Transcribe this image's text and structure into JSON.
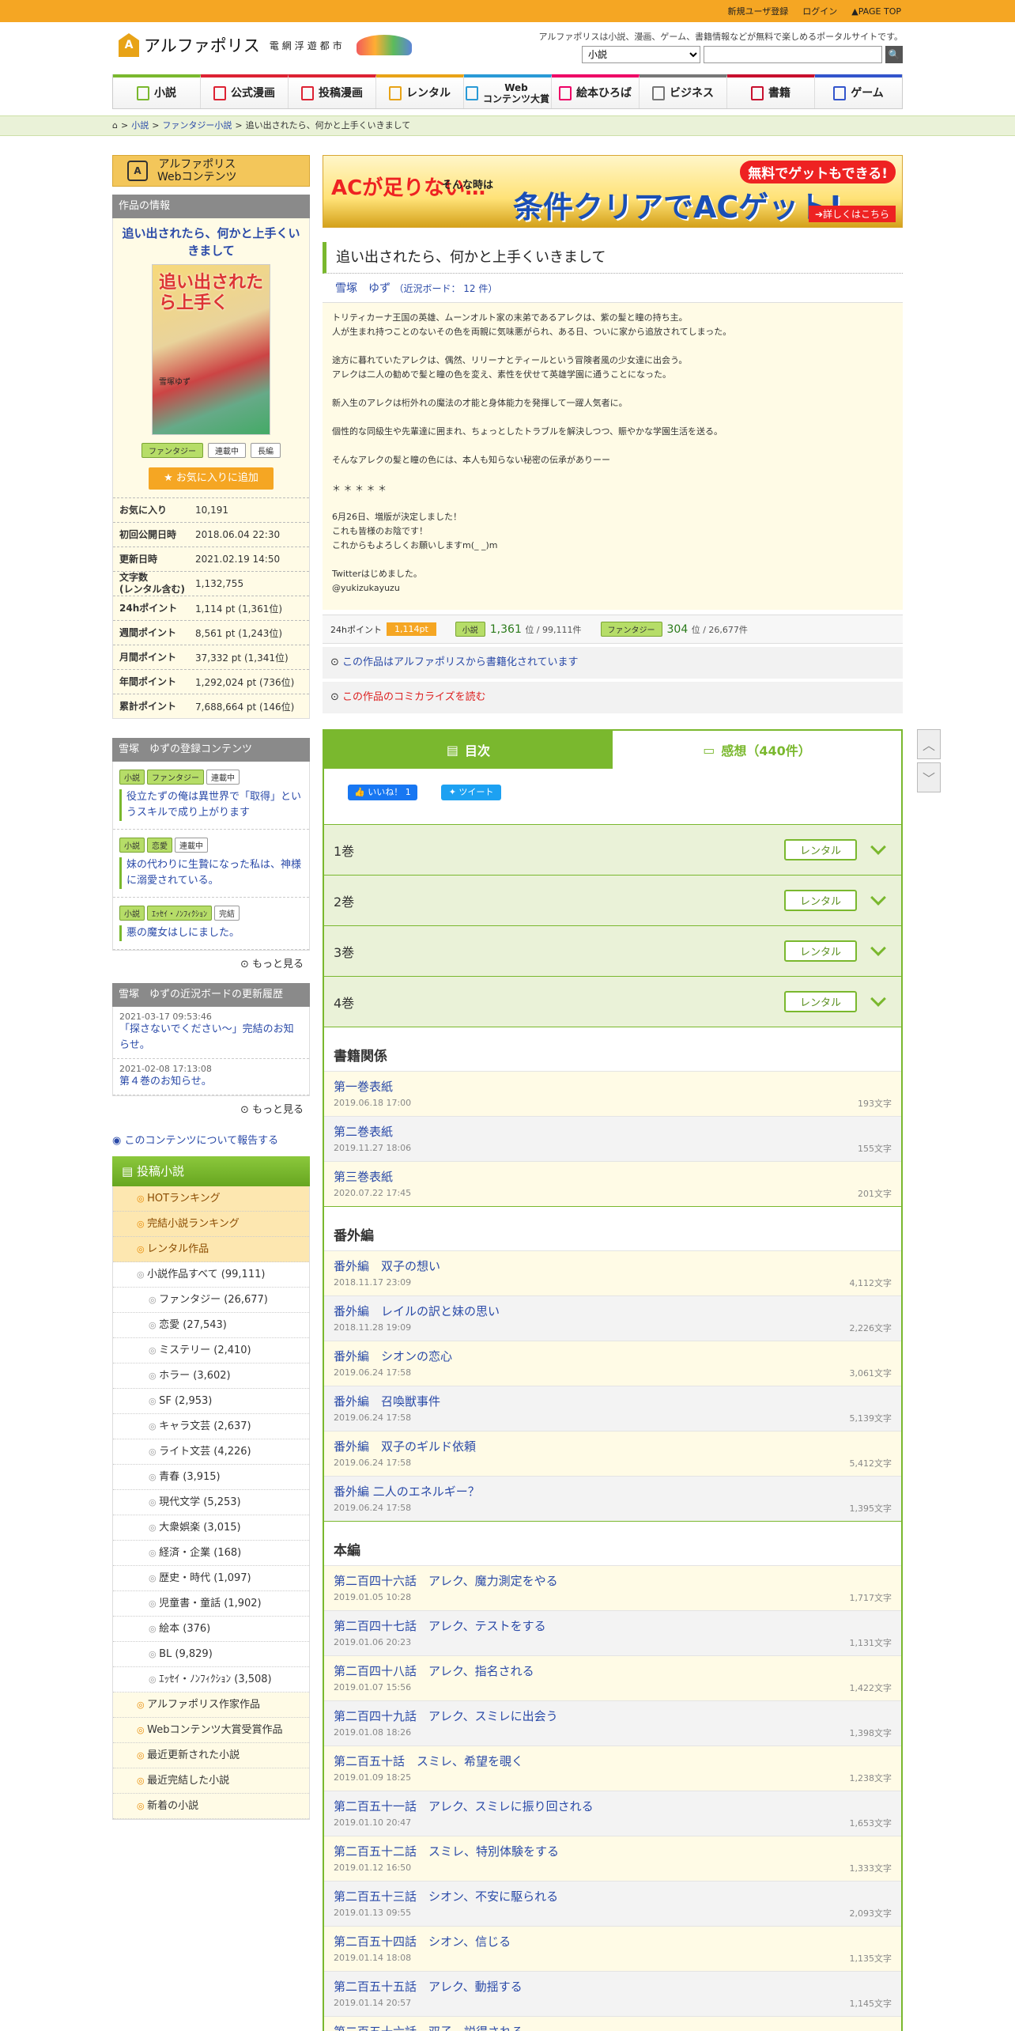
{
  "topbar": {
    "register": "新規ユーザ登録",
    "login": "ログイン",
    "pagetop": "PAGE TOP"
  },
  "header": {
    "logo_mark": "A",
    "logo": "アルファポリス",
    "logo_sub": "電網浮遊都市",
    "tagline": "アルファポリスは小説、漫画、ゲーム、書籍情報などが無料で楽しめるポータルサイトです。",
    "search_category": "小説",
    "search_icon": "search-icon"
  },
  "nav": [
    {
      "label": "小説",
      "color": "#7ab82e"
    },
    {
      "label": "公式漫画",
      "color": "#d23"
    },
    {
      "label": "投稿漫画",
      "color": "#d23"
    },
    {
      "label": "レンタル",
      "color": "#e8a317"
    },
    {
      "label": "Web\nコンテンツ大賞",
      "color": "#2a9ad6"
    },
    {
      "label": "絵本ひろば",
      "color": "#e06"
    },
    {
      "label": "ビジネス",
      "color": "#777"
    },
    {
      "label": "書籍",
      "color": "#c8102e"
    },
    {
      "label": "ゲーム",
      "color": "#35c"
    }
  ],
  "breadcrumb": [
    "小説",
    "ファンタジー小説",
    "追い出されたら、何かと上手くいきまして"
  ],
  "sidebar": {
    "banner_line1": "アルファポリス",
    "banner_line2": "Webコンテンツ",
    "info_head": "作品の情報",
    "title": "追い出されたら、何かと上手くいきまして",
    "cover_title": "追い出されたら上手く",
    "cover_author": "雪塚ゆず",
    "tags": [
      "ファンタジー",
      "連載中",
      "長編"
    ],
    "fav_button": "お気に入りに追加",
    "stats": [
      {
        "k": "お気に入り",
        "v": "10,191"
      },
      {
        "k": "初回公開日時",
        "v": "2018.06.04 22:30"
      },
      {
        "k": "更新日時",
        "v": "2021.02.19 14:50"
      },
      {
        "k": "文字数\n(レンタル含む)",
        "v": "1,132,755"
      },
      {
        "k": "24hポイント",
        "v": "1,114 pt (1,361位)"
      },
      {
        "k": "週間ポイント",
        "v": "8,561 pt (1,243位)"
      },
      {
        "k": "月間ポイント",
        "v": "37,332 pt (1,341位)"
      },
      {
        "k": "年間ポイント",
        "v": "1,292,024 pt (736位)"
      },
      {
        "k": "累計ポイント",
        "v": "7,688,664 pt (146位)"
      }
    ],
    "reg_head": "雪塚　ゆずの登録コンテンツ",
    "reg_items": [
      {
        "tags": [
          "小説",
          "ファンタジー",
          "連載中"
        ],
        "title": "役立たずの俺は異世界で「取得」というスキルで成り上がります"
      },
      {
        "tags": [
          "小説",
          "恋愛",
          "連載中"
        ],
        "title": "妹の代わりに生贄になった私は、神様に溺愛されている。"
      },
      {
        "tags": [
          "小説",
          "ｴｯｾｲ・ﾉﾝﾌｨｸｼｮﾝ",
          "完結"
        ],
        "title": "悪の魔女はしにました。"
      }
    ],
    "more1": "もっと見る",
    "upd_head": "雪塚　ゆずの近況ボードの更新履歴",
    "updates": [
      {
        "date": "2021-03-17 09:53:46",
        "title": "「探さないでください〜」完結のお知らせ。"
      },
      {
        "date": "2021-02-08 17:13:08",
        "title": "第４巻のお知らせ。"
      }
    ],
    "more2": "もっと見る",
    "report": "このコンテンツについて報告する",
    "menu_head": "投稿小説",
    "menu": [
      {
        "label": "HOTランキング",
        "style": "or"
      },
      {
        "label": "完結小説ランキング",
        "style": "or"
      },
      {
        "label": "レンタル作品",
        "style": "or"
      },
      {
        "label": "小説作品すべて (99,111)",
        "style": ""
      },
      {
        "label": "ファンタジー (26,677)",
        "style": "ind"
      },
      {
        "label": "恋愛 (27,543)",
        "style": "ind"
      },
      {
        "label": "ミステリー (2,410)",
        "style": "ind"
      },
      {
        "label": "ホラー (3,602)",
        "style": "ind"
      },
      {
        "label": "SF (2,953)",
        "style": "ind"
      },
      {
        "label": "キャラ文芸 (2,637)",
        "style": "ind"
      },
      {
        "label": "ライト文芸 (4,226)",
        "style": "ind"
      },
      {
        "label": "青春 (3,915)",
        "style": "ind"
      },
      {
        "label": "現代文学 (5,253)",
        "style": "ind"
      },
      {
        "label": "大衆娯楽 (3,015)",
        "style": "ind"
      },
      {
        "label": "経済・企業 (168)",
        "style": "ind"
      },
      {
        "label": "歴史・時代 (1,097)",
        "style": "ind"
      },
      {
        "label": "児童書・童話 (1,902)",
        "style": "ind"
      },
      {
        "label": "絵本 (376)",
        "style": "ind"
      },
      {
        "label": "BL (9,829)",
        "style": "ind"
      },
      {
        "label": "ｴｯｾｲ・ﾉﾝﾌｨｸｼｮﾝ (3,508)",
        "style": "ind"
      },
      {
        "label": "アルファポリス作家作品",
        "style": "y"
      },
      {
        "label": "Webコンテンツ大賞受賞作品",
        "style": "y"
      },
      {
        "label": "最近更新された小説",
        "style": "y"
      },
      {
        "label": "最近完結した小説",
        "style": "y"
      },
      {
        "label": "新着の小説",
        "style": "y"
      }
    ]
  },
  "ad": {
    "l1": "ACが足りない…",
    "l2": "そんな時は",
    "l3": "条件クリアでACゲット!",
    "l4": "無料でゲットもできる!",
    "l5": "➔詳しくはこちら"
  },
  "main": {
    "title": "追い出されたら、何かと上手くいきまして",
    "author": "雪塚　ゆず",
    "board": "（近況ボード： 12 件）",
    "synopsis": "トリティカーナ王国の英雄、ムーンオルト家の末弟であるアレクは、紫の髪と瞳の持ち主。\n人が生まれ持つことのないその色を両親に気味悪がられ、ある日、ついに家から追放されてしまった。\n\n途方に暮れていたアレクは、偶然、リリーナとティールという冒険者風の少女達に出会う。\nアレクは二人の勧めで髪と瞳の色を変え、素性を伏せて英雄学園に通うことになった。\n\n新入生のアレクは桁外れの魔法の才能と身体能力を発揮して一躍人気者に。\n\n個性的な同級生や先輩達に囲まれ、ちょっとしたトラブルを解決しつつ、賑やかな学園生活を送る。\n\nそんなアレクの髪と瞳の色には、本人も知らない秘密の伝承がありーー\n\n＊ ＊ ＊ ＊ ＊\n\n6月26日、増版が決定しました！\nこれも皆様のお陰です！\nこれからもよろしくお願いしますm(_ _)m\n\nTwitterはじめました。\n@yukizukayuzu",
    "pt_label": "24hポイント",
    "pt": "1,114pt",
    "rank1_tag": "小説",
    "rank1": "1,361",
    "rank1_total": "位 / 99,111件",
    "rank2_tag": "ファンタジー",
    "rank2": "304",
    "rank2_total": "位 / 26,677件",
    "link1": "この作品はアルファポリスから書籍化されています",
    "link2": "この作品のコミカライズを読む",
    "tab_toc": "目次",
    "tab_review": "感想（440件）",
    "fb": "いいね！ 1",
    "tw": "ツイート",
    "rental": "レンタル",
    "volumes": [
      "1巻",
      "2巻",
      "3巻",
      "4巻"
    ],
    "sections": [
      {
        "name": "書籍関係",
        "eps": [
          {
            "t": "第一巻表紙",
            "d": "2019.06.18 17:00",
            "c": "193文字"
          },
          {
            "t": "第二巻表紙",
            "d": "2019.11.27 18:06",
            "c": "155文字"
          },
          {
            "t": "第三巻表紙",
            "d": "2020.07.22 17:45",
            "c": "201文字"
          }
        ]
      },
      {
        "name": "番外編",
        "eps": [
          {
            "t": "番外編　双子の想い",
            "d": "2018.11.17 23:09",
            "c": "4,112文字"
          },
          {
            "t": "番外編　レイルの訳と妹の思い",
            "d": "2018.11.28 19:09",
            "c": "2,226文字"
          },
          {
            "t": "番外編　シオンの恋心",
            "d": "2019.06.24 17:58",
            "c": "3,061文字"
          },
          {
            "t": "番外編　召喚獣事件",
            "d": "2019.06.24 17:58",
            "c": "5,139文字"
          },
          {
            "t": "番外編　双子のギルド依頼",
            "d": "2019.06.24 17:58",
            "c": "5,412文字"
          },
          {
            "t": "番外編 二人のエネルギー？",
            "d": "2019.06.24 17:58",
            "c": "1,395文字"
          }
        ]
      },
      {
        "name": "本編",
        "eps": [
          {
            "t": "第二百四十六話　アレク、魔力測定をやる",
            "d": "2019.01.05 10:28",
            "c": "1,717文字"
          },
          {
            "t": "第二百四十七話　アレク、テストをする",
            "d": "2019.01.06 20:23",
            "c": "1,131文字"
          },
          {
            "t": "第二百四十八話　アレク、指名される",
            "d": "2019.01.07 15:56",
            "c": "1,422文字"
          },
          {
            "t": "第二百四十九話　アレク、スミレに出会う",
            "d": "2019.01.08 18:26",
            "c": "1,398文字"
          },
          {
            "t": "第二百五十話　スミレ、希望を覗く",
            "d": "2019.01.09 18:25",
            "c": "1,238文字"
          },
          {
            "t": "第二百五十一話　アレク、スミレに振り回される",
            "d": "2019.01.10 20:47",
            "c": "1,653文字"
          },
          {
            "t": "第二百五十二話　スミレ、特別体験をする",
            "d": "2019.01.12 16:50",
            "c": "1,333文字"
          },
          {
            "t": "第二百五十三話　シオン、不安に駆られる",
            "d": "2019.01.13 09:55",
            "c": "2,093文字"
          },
          {
            "t": "第二百五十四話　シオン、信じる",
            "d": "2019.01.14 18:08",
            "c": "1,135文字"
          },
          {
            "t": "第二百五十五話　アレク、動揺する",
            "d": "2019.01.14 20:57",
            "c": "1,145文字"
          },
          {
            "t": "第二百五十六話　双子、説得される",
            "d": "",
            "c": ""
          }
        ]
      }
    ]
  }
}
